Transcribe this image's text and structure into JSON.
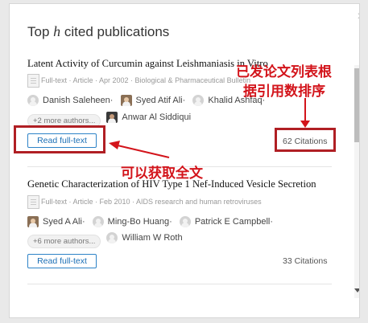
{
  "dialog": {
    "title_prefix": "Top ",
    "title_h": "h",
    "title_suffix": " cited publications",
    "close_glyph": "×"
  },
  "publications": [
    {
      "title": "Latent Activity of Curcumin against Leishmaniasis in Vitro",
      "meta": "Full-text · Article · Apr 2002 · Biological & Pharmaceutical Bulletin",
      "authors": [
        {
          "name": "Danish Saleheen",
          "sep": " ·"
        },
        {
          "name": "Syed Atif Ali",
          "sep": " ·"
        },
        {
          "name": "Khalid Ashfaq",
          "sep": " ·"
        }
      ],
      "more_authors": "+2 more authors...",
      "last_author": "Anwar Al Siddiqui",
      "read_button": "Read full-text",
      "citations": "62 Citations"
    },
    {
      "title": "Genetic Characterization of HIV Type 1 Nef-Induced Vesicle Secretion",
      "meta": "Full-text · Article · Feb 2010 · AIDS research and human retroviruses",
      "authors": [
        {
          "name": "Syed A Ali",
          "sep": " ·"
        },
        {
          "name": "Ming-Bo Huang",
          "sep": " ·"
        },
        {
          "name": "Patrick E Campbell",
          "sep": " ·"
        }
      ],
      "more_authors": "+6 more authors...",
      "last_author": "William W Roth",
      "read_button": "Read full-text",
      "citations": "33 Citations"
    }
  ],
  "annotations": {
    "top_right_line1": "已发论文列表根",
    "top_right_line2": "据引用数排序",
    "bottom": "可以获取全文",
    "color": "#d3141b"
  }
}
